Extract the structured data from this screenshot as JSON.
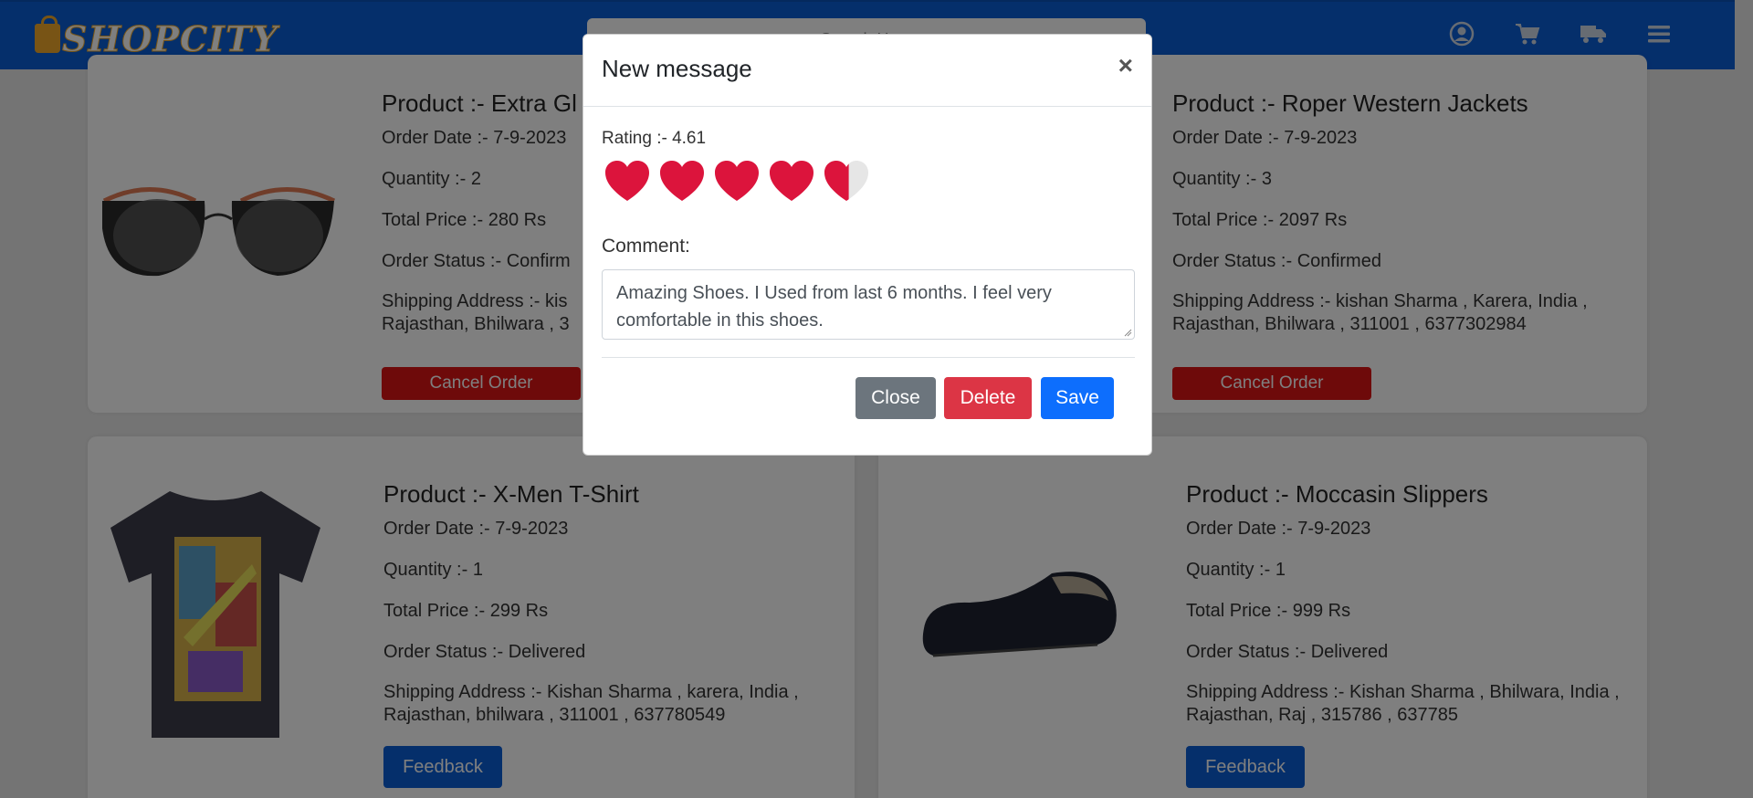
{
  "header": {
    "logo_text": "SHOPCITY",
    "search_placeholder": "Search Here"
  },
  "orders": [
    {
      "title": "Product :- Extra Gl",
      "order_date": "Order Date :- 7-9-2023",
      "quantity": "Quantity :- 2",
      "total_price": "Total Price :- 280 Rs",
      "status": "Order Status :- Confirm",
      "address": "Shipping Address :- kis Rajasthan, Bhilwara , 3",
      "action": "Cancel Order"
    },
    {
      "title": "Product :- Roper Western Jackets",
      "order_date": "Order Date :- 7-9-2023",
      "quantity": "Quantity :- 3",
      "total_price": "Total Price :- 2097 Rs",
      "status": "Order Status :- Confirmed",
      "address": "Shipping Address :- kishan Sharma , Karera, India , Rajasthan, Bhilwara , 311001 , 6377302984",
      "action": "Cancel Order"
    },
    {
      "title": "Product :- X-Men T-Shirt",
      "order_date": "Order Date :- 7-9-2023",
      "quantity": "Quantity :- 1",
      "total_price": "Total Price :- 299 Rs",
      "status": "Order Status :- Delivered",
      "address": "Shipping Address :- Kishan Sharma , karera, India , Rajasthan, bhilwara , 311001 , 637780549",
      "action": "Feedback"
    },
    {
      "title": "Product :- Moccasin Slippers",
      "order_date": "Order Date :- 7-9-2023",
      "quantity": "Quantity :- 1",
      "total_price": "Total Price :- 999 Rs",
      "status": "Order Status :- Delivered",
      "address": "Shipping Address :- Kishan Sharma , Bhilwara, India , Rajasthan, Raj , 315786 , 637785",
      "action": "Feedback"
    }
  ],
  "modal": {
    "title": "New message",
    "close_symbol": "×",
    "rating_label": "Rating :- 4.61",
    "rating_value": 4.61,
    "rating_max": 5,
    "comment_label": "Comment:",
    "comment_text": "Amazing Shoes. I Used from last 6 months. I feel very comfortable in this shoes.",
    "buttons": {
      "close": "Close",
      "delete": "Delete",
      "save": "Save"
    }
  },
  "colors": {
    "navbar": "#0b5ed7",
    "heart": "#dc143c",
    "cancel": "#dc1414",
    "feedback": "#0b5ed7"
  }
}
